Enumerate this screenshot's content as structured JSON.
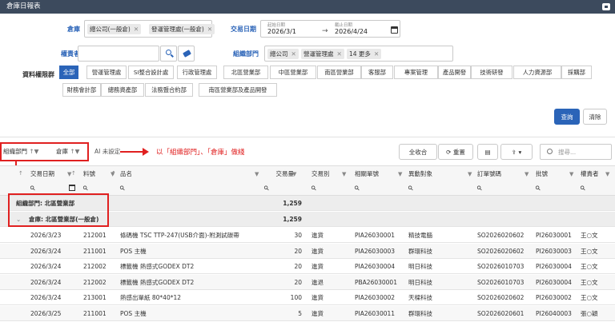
{
  "window": {
    "title": "倉庫日報表"
  },
  "filters": {
    "warehouse": {
      "label": "倉庫",
      "chips": [
        "總公司(一般倉)",
        "發運管理處(一般倉)"
      ]
    },
    "date": {
      "label": "交易日期",
      "start_caption": "起始日期",
      "start": "2026/3/1",
      "end_caption": "截止日期",
      "end": "2026/4/24"
    },
    "manager": {
      "label": "權責者",
      "value": ""
    },
    "org": {
      "label": "組織部門",
      "chips": [
        "總公司",
        "營運管理處",
        "14 更多"
      ]
    },
    "perm": {
      "label": "資料權限群",
      "items": [
        "全部",
        "營運管理處",
        "SI整合設計處",
        "行政管理處",
        "北區營業部",
        "中區營業部",
        "南區營業部",
        "客服部",
        "專案管理",
        "產品開發",
        "技術研發",
        "人力資源部",
        "採購部",
        "財務會計部",
        "總務資產部",
        "法務暨合約部",
        "南區營業部及產品開發"
      ]
    }
  },
  "actions": {
    "query": "查詢",
    "clear": "清除"
  },
  "toolbar": {
    "group1": "組織部門",
    "group2": "倉庫",
    "ai": "AI 未設定",
    "annotation": "以「組織部門」、「倉庫」做綫",
    "collapse": "全收合",
    "reload": "重置",
    "search_placeholder": "搜尋..."
  },
  "columns": [
    "交易日期",
    "料號",
    "品名",
    "交易量",
    "交易別",
    "相關單號",
    "異動對象",
    "訂單號碼",
    "批號",
    "權責者"
  ],
  "groups": {
    "g1": {
      "label": "組織部門: 北區營業部",
      "total": "1,259"
    },
    "g2": {
      "label": "倉庫: 北區營業部(一般倉)",
      "total": "1,259"
    }
  },
  "rows": [
    [
      "2026/3/23",
      "212001",
      "條碼機 TSC TTP-247(USB介面)-附測試碳帶",
      "30",
      "進貨",
      "PIA26030001",
      "精技電腦",
      "SO2026020602",
      "PI26030001",
      "王○文"
    ],
    [
      "2026/3/24",
      "211001",
      "POS 主機",
      "20",
      "進貨",
      "PIA26030003",
      "群環科技",
      "SO2026020602",
      "PI26030003",
      "王○文"
    ],
    [
      "2026/3/24",
      "212002",
      "標籤機 熱感式GODEX DT2",
      "20",
      "進貨",
      "PIA26030004",
      "明日科技",
      "SO2026010703",
      "PI26030004",
      "王○文"
    ],
    [
      "2026/3/24",
      "212002",
      "標籤機 熱感式GODEX DT2",
      "20",
      "進退",
      "PBA26030001",
      "明日科技",
      "SO2026010703",
      "PI26030004",
      "王○文"
    ],
    [
      "2026/3/24",
      "213001",
      "熱感出單紙 80*40*12",
      "100",
      "進貨",
      "PIA26030002",
      "天樑科技",
      "SO2026020602",
      "PI26030002",
      "王○文"
    ],
    [
      "2026/3/25",
      "211001",
      "POS 主機",
      "5",
      "進貨",
      "PIA26030011",
      "群環科技",
      "SO2026020601",
      "PI26040003",
      "張○穎"
    ]
  ],
  "colors": {
    "accent": "#2b64b8",
    "title_bg": "#3c4a5d",
    "annotation": "#e02020"
  }
}
